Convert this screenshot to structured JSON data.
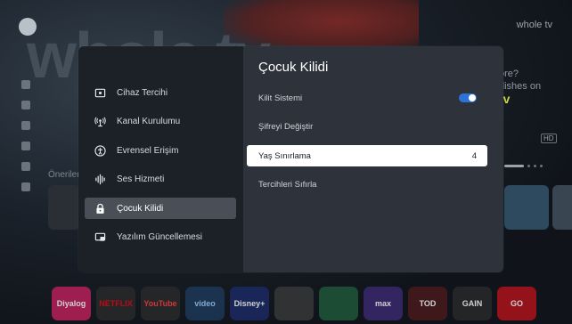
{
  "background": {
    "brand": "whole tv",
    "hero_word": "whole tv",
    "promo_lines": [
      "ore?",
      "dishes on",
      "tv"
    ],
    "recommendations_label": "Öneriler",
    "hd_badge": "HD",
    "apps": [
      {
        "name": "Diyalog",
        "label": "Diyalog",
        "color": "#c0205c"
      },
      {
        "name": "Netflix",
        "label": "NETFLIX",
        "color": "#2a2a2a"
      },
      {
        "name": "YouTube",
        "label": "YouTube",
        "color": "#2a2a2a"
      },
      {
        "name": "Prime Video",
        "label": "video",
        "color": "#1e3a5c"
      },
      {
        "name": "Disney+",
        "label": "Disney+",
        "color": "#1b2a66"
      },
      {
        "name": "App",
        "label": "",
        "color": "#3a3a3a"
      },
      {
        "name": "App2",
        "label": "",
        "color": "#1f5a3a"
      },
      {
        "name": "HBO Max",
        "label": "max",
        "color": "#3b2a72"
      },
      {
        "name": "TOD",
        "label": "TOD",
        "color": "#4a1a1a"
      },
      {
        "name": "Gain",
        "label": "GAIN",
        "color": "#2a2a2a"
      },
      {
        "name": "Go",
        "label": "GO",
        "color": "#b5121b"
      }
    ]
  },
  "settings": {
    "menu": [
      {
        "label": "Cihaz Tercihi",
        "icon": "device-icon",
        "active": false
      },
      {
        "label": "Kanal Kurulumu",
        "icon": "antenna-icon",
        "active": false
      },
      {
        "label": "Evrensel Erişim",
        "icon": "accessibility-icon",
        "active": false
      },
      {
        "label": "Ses Hizmeti",
        "icon": "voice-icon",
        "active": false
      },
      {
        "label": "Çocuk Kilidi",
        "icon": "lock-icon",
        "active": true
      },
      {
        "label": "Yazılım Güncellemesi",
        "icon": "software-update-icon",
        "active": false
      }
    ],
    "panel": {
      "title": "Çocuk Kilidi",
      "options": [
        {
          "label": "Kilit Sistemi",
          "type": "toggle",
          "value": true
        },
        {
          "label": "Şifreyi Değiştir",
          "type": "action"
        },
        {
          "label": "Yaş Sınırlama",
          "type": "value",
          "value": "4",
          "focused": true
        },
        {
          "label": "Tercihleri Sıfırla",
          "type": "action"
        }
      ]
    },
    "colors": {
      "toggle_on": "#2d72d9",
      "menu_bg": "#1c2027",
      "panel_bg": "#2e333b",
      "active_item": "#4a4f57",
      "focus_item": "#ffffff"
    }
  }
}
